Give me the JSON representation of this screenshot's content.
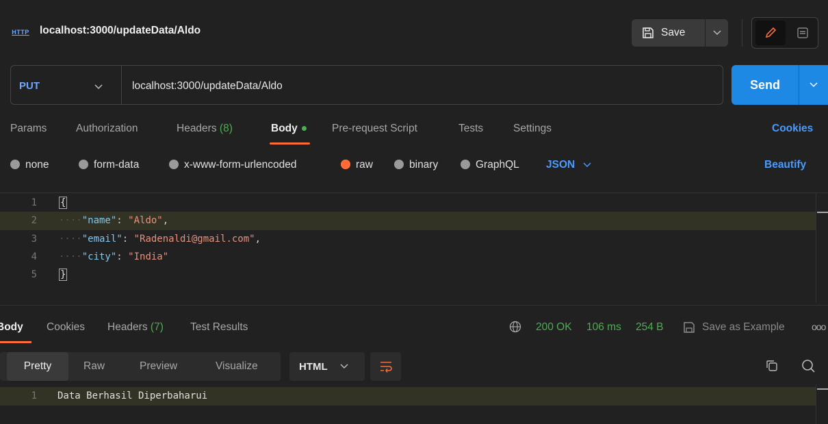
{
  "titlebar": {
    "http_badge": "HTTP",
    "tab_title": "localhost:3000/updateData/Aldo",
    "save_label": "Save"
  },
  "request": {
    "method": "PUT",
    "url": "localhost:3000/updateData/Aldo",
    "send_label": "Send"
  },
  "request_tabs": {
    "params": "Params",
    "authorization": "Authorization",
    "headers": "Headers",
    "headers_count": "(8)",
    "body": "Body",
    "prerequest": "Pre-request Script",
    "tests": "Tests",
    "settings": "Settings",
    "cookies": "Cookies"
  },
  "body_types": {
    "none": "none",
    "form_data": "form-data",
    "urlencoded": "x-www-form-urlencoded",
    "raw": "raw",
    "binary": "binary",
    "graphql": "GraphQL",
    "format": "JSON",
    "beautify": "Beautify"
  },
  "editor": {
    "line_numbers": [
      "1",
      "2",
      "3",
      "4",
      "5"
    ],
    "open_brace": "{",
    "close_brace": "}",
    "indent": "····",
    "key_name": "\"name\"",
    "val_name": "\"Aldo\"",
    "key_email": "\"email\"",
    "val_email": "\"Radenaldi@gmail.com\"",
    "key_city": "\"city\"",
    "val_city": "\"India\""
  },
  "response_tabs": {
    "body": "Body",
    "cookies": "Cookies",
    "headers": "Headers",
    "headers_count": "(7)",
    "test_results": "Test Results"
  },
  "response_status": {
    "status": "200 OK",
    "time": "106 ms",
    "size": "254 B",
    "save_example": "Save as Example",
    "more": "ooo"
  },
  "response_view": {
    "pretty": "Pretty",
    "raw": "Raw",
    "preview": "Preview",
    "visualize": "Visualize",
    "format": "HTML"
  },
  "response_body": {
    "line_number": "1",
    "text": "Data Berhasil Diperbaharui"
  },
  "colors": {
    "accent": "#ff6c37",
    "send_blue": "#1e88e5",
    "link_blue": "#4a9bff",
    "success_green": "#4caf50"
  }
}
